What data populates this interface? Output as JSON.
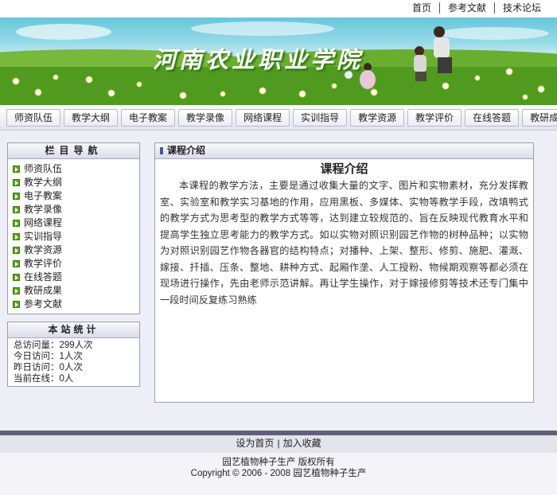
{
  "toplinks": [
    "首页",
    "参考文献",
    "技术论坛"
  ],
  "banner": {
    "title": "河南农业职业学院"
  },
  "nav": [
    "师资队伍",
    "教学大纲",
    "电子教案",
    "教学录像",
    "网络课程",
    "实训指导",
    "教学资源",
    "教学评价",
    "在线答题",
    "教研成果"
  ],
  "sidebar": {
    "title": "栏目导航",
    "items": [
      "师资队伍",
      "教学大纲",
      "电子教案",
      "教学录像",
      "网络课程",
      "实训指导",
      "教学资源",
      "教学评价",
      "在线答题",
      "教研成果",
      "参考文献"
    ]
  },
  "stats": {
    "title": "本站统计",
    "rows": [
      "总访问量：299人次",
      "今日访问：1人次",
      "昨日访问：0人次",
      "当前在线：0人"
    ]
  },
  "content": {
    "header": "课程介绍",
    "title": "课程介绍",
    "body": "本课程的教学方法，主要是通过收集大量的文字、图片和实物素材，充分发挥教室、实验室和教学实习基地的作用，应用黑板、多媒体、实物等教学手段，改填鸭式的教学方式为思考型的教学方式等等，达到建立较规范的、旨在反映现代教育水平和提高学生独立思考能力的教学方式。如以实物对照识别园艺作物的树种品种；以实物为对照识别园艺作物各器官的结构特点；对播种、上架、整形、修剪、施肥、灌溉、嫁接、扦插、压条、整地、耕种方式、起厢作垄、人工授粉、物候期观察等都必须在现场进行操作，先由老师示范讲解。再让学生操作，对于嫁接修剪等技术还专门集中一段时间反复练习熟练"
  },
  "footer": {
    "links": [
      "设为首页",
      "加入收藏"
    ],
    "separator": "|",
    "line1": "园艺植物种子生产  版权所有",
    "line2": "Copyright © 2006 - 2008  园艺植物种子生产"
  }
}
